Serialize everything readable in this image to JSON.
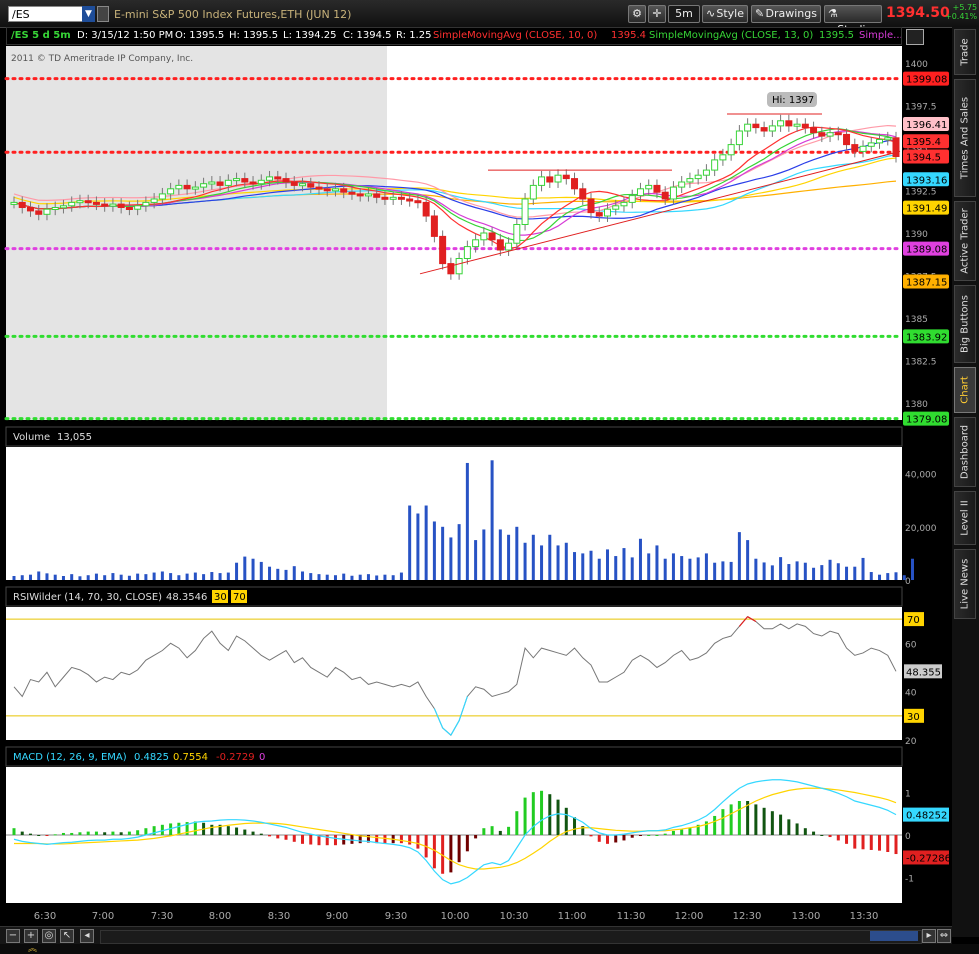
{
  "toolbar": {
    "symbol": "/ES",
    "description": "E-mini S&P 500 Index Futures,ETH (JUN 12)",
    "timeframe": "5m",
    "style_label": "Style",
    "drawings_label": "Drawings",
    "studies_label": "Studies",
    "last_price": "1394.50",
    "net_change": "+5.75",
    "net_change_pct": "+0.41%",
    "icons": [
      "gear-icon",
      "crosshair-icon",
      "line-chart-icon",
      "pencil-icon",
      "flask-icon"
    ]
  },
  "info_bar": {
    "symbol_period": "/ES 5 d 5m",
    "date": "D: 3/15/12 1:50 PM",
    "open": "O: 1395.5",
    "high": "H: 1395.5",
    "low": "L: 1394.25",
    "close": "C: 1394.5",
    "range": "R: 1.25",
    "sma1_label": "SimpleMovingAvg (CLOSE, 10, 0)",
    "sma1_value": "1395.4",
    "sma2_label": "SimpleMovingAvg (CLOSE, 13, 0)",
    "sma2_value": "1395.5",
    "sma3_label": "Simple..."
  },
  "sidebar": {
    "tabs": [
      "Trade",
      "Times And Sales",
      "Active Trader",
      "Big Buttons",
      "Chart",
      "Dashboard",
      "Level II",
      "Live News"
    ],
    "active_tab": "Chart"
  },
  "colors": {
    "background": "#000000",
    "bull": "#37d437",
    "bear": "#e02020",
    "volume": "#2752c4",
    "sma10": "#ff3030",
    "sma13": "#37d437",
    "sma_magenta": "#d63cd6",
    "sma_blue": "#2a3ee8",
    "sma_cyan": "#35d8ff",
    "sma_yellow": "#ffd400",
    "sma_orange": "#ffb000",
    "sma_pink": "#ff9aa8"
  },
  "chart_data": [
    {
      "type": "candlestick",
      "title": "Price",
      "copyright": "2011 © TD Ameritrade IP Company, Inc.",
      "ylim": [
        1379,
        1401
      ],
      "yticks": [
        "1400",
        "1397.5",
        "1395",
        "1392.5",
        "1390",
        "1387.5",
        "1385",
        "1382.5",
        "1380"
      ],
      "xticks": [
        "6:30",
        "7:00",
        "7:30",
        "8:00",
        "8:30",
        "9:00",
        "9:30",
        "10:00",
        "10:30",
        "11:00",
        "11:30",
        "12:00",
        "12:30",
        "13:00",
        "13:30"
      ],
      "annotation": "Hi: 1397",
      "levels": [
        {
          "value": 1399.08,
          "label": "1399.08",
          "color": "#ff2020"
        },
        {
          "value": 1394.75,
          "label": "",
          "color": "#ff2020"
        },
        {
          "value": 1389.08,
          "label": "1389.08",
          "color": "#e040e0"
        },
        {
          "value": 1383.92,
          "label": "1383.92",
          "color": "#30dd30"
        },
        {
          "value": 1379.08,
          "label": "1379.08",
          "color": "#30dd30"
        }
      ],
      "price_labels": [
        {
          "value": 1396.41,
          "label": "1396.41",
          "bg": "#ffc0c8",
          "fg": "#000000"
        },
        {
          "value": 1395.4,
          "label": "1395.4",
          "bg": "#ff3030",
          "fg": "#000000"
        },
        {
          "value": 1394.5,
          "label": "1394.5",
          "bg": "#ff3030",
          "fg": "#000000"
        },
        {
          "value": 1393.16,
          "label": "1393.16",
          "bg": "#35d8ff",
          "fg": "#000000"
        },
        {
          "value": 1391.49,
          "label": "1391.49",
          "bg": "#ffd400",
          "fg": "#000000"
        },
        {
          "value": 1387.15,
          "label": "1387.15",
          "bg": "#ffb000",
          "fg": "#000000"
        }
      ],
      "closes": [
        1391.8,
        1391.5,
        1391.3,
        1391.1,
        1391.4,
        1391.5,
        1391.6,
        1391.8,
        1391.9,
        1391.8,
        1391.7,
        1391.6,
        1391.7,
        1391.5,
        1391.4,
        1391.6,
        1391.8,
        1392.0,
        1392.3,
        1392.6,
        1392.8,
        1392.6,
        1392.7,
        1392.9,
        1393.0,
        1392.8,
        1393.1,
        1393.2,
        1393.0,
        1392.9,
        1393.1,
        1393.3,
        1393.2,
        1393.0,
        1392.8,
        1392.9,
        1392.7,
        1392.6,
        1392.5,
        1392.6,
        1392.4,
        1392.3,
        1392.2,
        1392.3,
        1392.1,
        1392.0,
        1392.1,
        1392.0,
        1391.9,
        1391.8,
        1391.0,
        1389.8,
        1388.2,
        1387.6,
        1388.5,
        1389.2,
        1389.6,
        1390.0,
        1389.6,
        1389.0,
        1389.4,
        1390.5,
        1392.0,
        1392.8,
        1393.3,
        1393.0,
        1393.4,
        1393.2,
        1392.6,
        1392.0,
        1391.2,
        1391.0,
        1391.4,
        1391.6,
        1391.8,
        1392.2,
        1392.6,
        1392.8,
        1392.4,
        1392.0,
        1392.7,
        1393.0,
        1393.2,
        1393.4,
        1393.7,
        1394.3,
        1394.6,
        1395.2,
        1396.0,
        1396.4,
        1396.2,
        1396.0,
        1396.3,
        1396.6,
        1396.3,
        1396.4,
        1396.2,
        1395.9,
        1395.7,
        1395.9,
        1395.8,
        1395.2,
        1394.8,
        1395.1,
        1395.3,
        1395.5,
        1395.6,
        1394.5
      ]
    },
    {
      "type": "bar",
      "title": "Volume",
      "value_label": "13,055",
      "ylim": [
        0,
        50000
      ],
      "yticks": [
        "40,000",
        "20,000",
        "0"
      ],
      "values": [
        1500,
        1800,
        2000,
        3200,
        2500,
        2000,
        1500,
        2200,
        1400,
        1800,
        2400,
        1800,
        2600,
        2000,
        1600,
        2400,
        2200,
        2800,
        3200,
        2600,
        1800,
        2400,
        2800,
        2200,
        3000,
        2600,
        2800,
        6500,
        8800,
        8000,
        6800,
        5000,
        4200,
        3800,
        5200,
        3200,
        2600,
        2200,
        2000,
        1800,
        2400,
        1600,
        2000,
        2200,
        1700,
        2000,
        1800,
        2800,
        28000,
        25000,
        28000,
        22000,
        20000,
        16000,
        21000,
        44000,
        15000,
        19000,
        45000,
        19000,
        17000,
        20000,
        14000,
        17000,
        13000,
        17000,
        13000,
        14000,
        10500,
        10000,
        11000,
        8000,
        11500,
        9000,
        12000,
        8500,
        15500,
        10000,
        13000,
        8000,
        10000,
        9000,
        8000,
        8500,
        10000,
        6500,
        7000,
        6800,
        18000,
        15000,
        8000,
        6600,
        5500,
        8600,
        6000,
        7000,
        6500,
        4600,
        5600,
        7600,
        6300,
        5000,
        5000,
        8300,
        3000,
        2000,
        2600,
        2900,
        1800,
        8000
      ]
    },
    {
      "type": "line",
      "title": "RSIWilder (14, 70, 30, CLOSE)",
      "value_label": "48.3546",
      "overbought_label": "30",
      "oversold_label": "70",
      "ylim": [
        20,
        75
      ],
      "yticks": [
        "60",
        "50",
        "40",
        "20"
      ],
      "levels": [
        {
          "value": 70,
          "label": "70"
        },
        {
          "value": 30,
          "label": "30"
        }
      ],
      "last_label": "48.355",
      "values": [
        42,
        38,
        45,
        44,
        48,
        42,
        46,
        50,
        49,
        47,
        44,
        46,
        45,
        48,
        47,
        49,
        53,
        55,
        57,
        60,
        58,
        54,
        57,
        62,
        65,
        60,
        57,
        63,
        61,
        58,
        55,
        53,
        55,
        57,
        52,
        54,
        50,
        48,
        46,
        50,
        48,
        45,
        46,
        43,
        44,
        43,
        42,
        43,
        42,
        44,
        38,
        33,
        25,
        22,
        28,
        38,
        42,
        41,
        38,
        39,
        40,
        43,
        58,
        54,
        58,
        57,
        56,
        55,
        58,
        54,
        51,
        44,
        44,
        46,
        48,
        53,
        55,
        53,
        50,
        52,
        55,
        57,
        53,
        54,
        56,
        60,
        62,
        63,
        67,
        71,
        69,
        66,
        66,
        68,
        66,
        68,
        67,
        64,
        63,
        65,
        64,
        58,
        55,
        56,
        58,
        57,
        55,
        48.4
      ]
    },
    {
      "type": "macd",
      "title": "MACD (12, 26, 9, EMA)",
      "value_label": "0.4825",
      "avg_label": "0.7554",
      "diff_label": "-0.2729",
      "zero_label": "0",
      "ylim": [
        -1.6,
        1.6
      ],
      "yticks": [
        "1",
        "0",
        "-1"
      ],
      "last_value_label": "0.48252",
      "last_diff_label": "-0.27286",
      "value_series": [
        -0.1,
        -0.15,
        -0.18,
        -0.2,
        -0.22,
        -0.2,
        -0.18,
        -0.17,
        -0.15,
        -0.13,
        -0.12,
        -0.12,
        -0.1,
        -0.1,
        -0.08,
        -0.05,
        0.0,
        0.05,
        0.1,
        0.15,
        0.2,
        0.25,
        0.3,
        0.32,
        0.33,
        0.35,
        0.36,
        0.36,
        0.35,
        0.33,
        0.3,
        0.26,
        0.22,
        0.18,
        0.12,
        0.06,
        0.02,
        -0.02,
        -0.05,
        -0.08,
        -0.1,
        -0.12,
        -0.14,
        -0.15,
        -0.18,
        -0.2,
        -0.22,
        -0.25,
        -0.3,
        -0.4,
        -0.6,
        -0.85,
        -1.05,
        -1.15,
        -1.1,
        -1.0,
        -0.85,
        -0.7,
        -0.65,
        -0.7,
        -0.6,
        -0.3,
        0.0,
        0.2,
        0.35,
        0.45,
        0.5,
        0.48,
        0.4,
        0.3,
        0.15,
        0.05,
        0.0,
        0.0,
        0.02,
        0.05,
        0.08,
        0.1,
        0.1,
        0.12,
        0.18,
        0.22,
        0.28,
        0.35,
        0.45,
        0.6,
        0.78,
        0.95,
        1.1,
        1.2,
        1.25,
        1.28,
        1.3,
        1.3,
        1.28,
        1.25,
        1.2,
        1.15,
        1.1,
        1.05,
        0.98,
        0.9,
        0.8,
        0.75,
        0.7,
        0.65,
        0.58,
        0.48
      ],
      "avg_series": [
        -0.2,
        -0.2,
        -0.2,
        -0.2,
        -0.21,
        -0.21,
        -0.21,
        -0.2,
        -0.19,
        -0.18,
        -0.17,
        -0.16,
        -0.15,
        -0.14,
        -0.13,
        -0.12,
        -0.1,
        -0.08,
        -0.05,
        -0.02,
        0.02,
        0.06,
        0.1,
        0.14,
        0.18,
        0.2,
        0.23,
        0.25,
        0.27,
        0.28,
        0.28,
        0.28,
        0.27,
        0.25,
        0.22,
        0.19,
        0.16,
        0.13,
        0.1,
        0.07,
        0.04,
        0.01,
        -0.02,
        -0.04,
        -0.06,
        -0.08,
        -0.1,
        -0.13,
        -0.16,
        -0.2,
        -0.27,
        -0.36,
        -0.48,
        -0.6,
        -0.7,
        -0.76,
        -0.8,
        -0.8,
        -0.78,
        -0.76,
        -0.72,
        -0.65,
        -0.55,
        -0.43,
        -0.3,
        -0.15,
        -0.02,
        0.08,
        0.14,
        0.17,
        0.17,
        0.15,
        0.13,
        0.11,
        0.1,
        0.09,
        0.09,
        0.1,
        0.1,
        0.1,
        0.12,
        0.14,
        0.17,
        0.2,
        0.25,
        0.32,
        0.4,
        0.5,
        0.6,
        0.7,
        0.8,
        0.88,
        0.95,
        1.0,
        1.05,
        1.08,
        1.1,
        1.1,
        1.1,
        1.08,
        1.06,
        1.03,
        1.0,
        0.96,
        0.92,
        0.88,
        0.83,
        0.76
      ]
    }
  ]
}
